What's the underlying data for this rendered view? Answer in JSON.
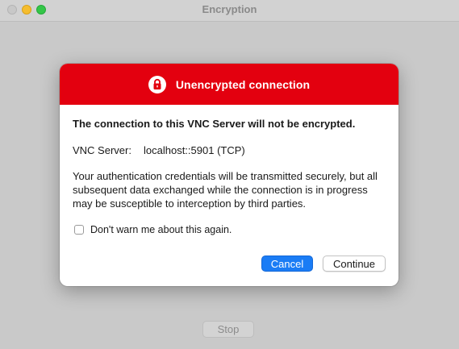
{
  "window": {
    "title": "Encryption",
    "stop_label": "Stop"
  },
  "dialog": {
    "header_title": "Unencrypted connection",
    "header_icon": "lock-icon",
    "header_color": "#e3000f",
    "headline": "The connection to this VNC Server will not be encrypted.",
    "server_label": "VNC Server:",
    "server_value": "localhost::5901 (TCP)",
    "description": "Your authentication credentials will be transmitted securely, but all subsequent data exchanged while the connection is in progress may be susceptible to interception by third parties.",
    "checkbox_label": "Don't warn me about this again.",
    "checkbox_checked": false,
    "cancel_label": "Cancel",
    "continue_label": "Continue",
    "accent_color": "#1a7cf5"
  }
}
